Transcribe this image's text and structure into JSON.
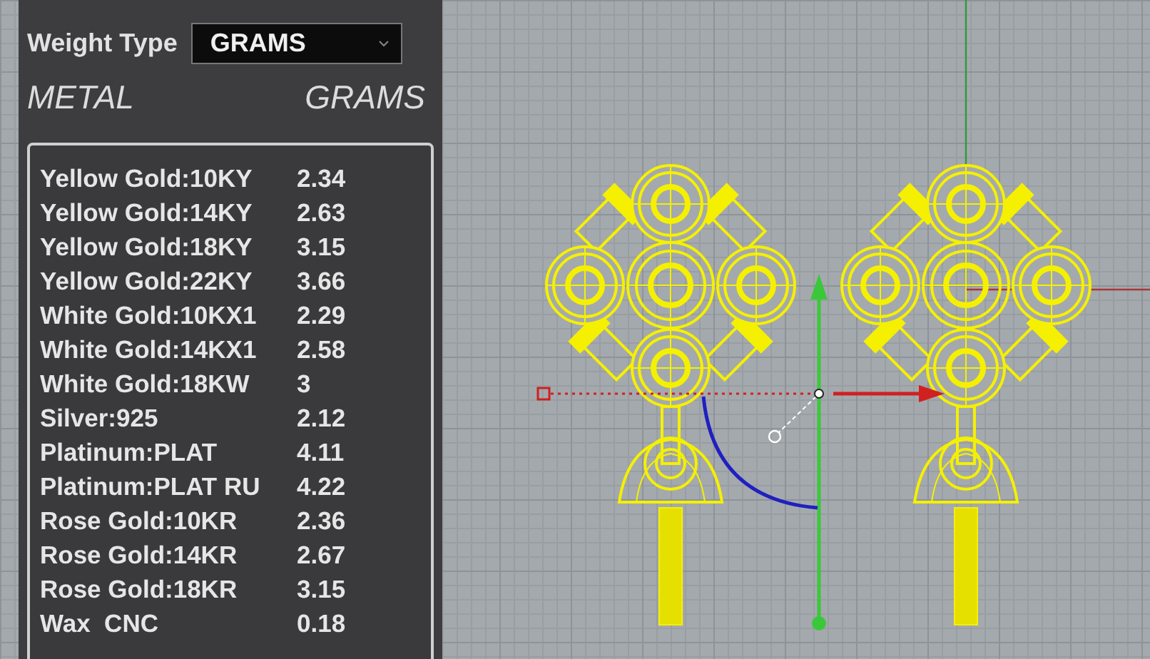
{
  "weight_type": {
    "label": "Weight Type",
    "value": "GRAMS"
  },
  "columns": {
    "metal": "METAL",
    "grams": "GRAMS"
  },
  "rows": [
    {
      "metal": "Yellow Gold:10KY",
      "grams": "2.34"
    },
    {
      "metal": "Yellow Gold:14KY",
      "grams": "2.63"
    },
    {
      "metal": "Yellow Gold:18KY",
      "grams": "3.15"
    },
    {
      "metal": "Yellow Gold:22KY",
      "grams": "3.66"
    },
    {
      "metal": "White Gold:10KX1",
      "grams": "2.29"
    },
    {
      "metal": "White Gold:14KX1",
      "grams": "2.58"
    },
    {
      "metal": "White Gold:18KW",
      "grams": "3"
    },
    {
      "metal": "Silver:925",
      "grams": "2.12"
    },
    {
      "metal": "Platinum:PLAT",
      "grams": "4.11"
    },
    {
      "metal": "Platinum:PLAT RU",
      "grams": "4.22"
    },
    {
      "metal": "Rose Gold:10KR",
      "grams": "2.36"
    },
    {
      "metal": "Rose Gold:14KR",
      "grams": "2.67"
    },
    {
      "metal": "Rose Gold:18KR",
      "grams": "3.15"
    },
    {
      "metal": "Wax  CNC",
      "grams": "0.18"
    }
  ]
}
